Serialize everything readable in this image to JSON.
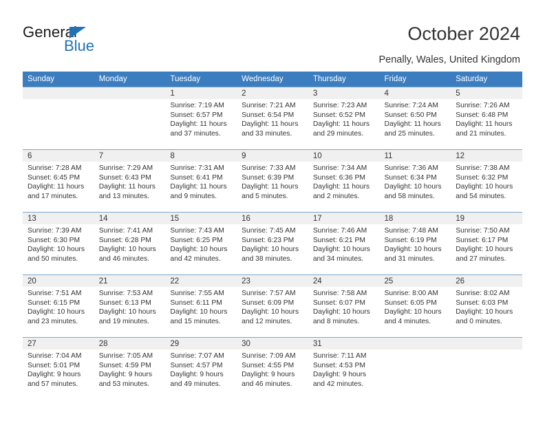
{
  "brand": {
    "name_top": "General",
    "name_bottom": "Blue",
    "accent_color": "#1f73b7",
    "triangle_icon": "triangle-icon"
  },
  "header": {
    "title": "October 2024",
    "subtitle": "Penally, Wales, United Kingdom"
  },
  "calendar": {
    "header_bg": "#3b7dbf",
    "header_text_color": "#ffffff",
    "daynum_band_bg": "#f0f0f0",
    "row_separator_color": "#7ba7cf",
    "weekday_headers": [
      "Sunday",
      "Monday",
      "Tuesday",
      "Wednesday",
      "Thursday",
      "Friday",
      "Saturday"
    ],
    "labels": {
      "sunrise": "Sunrise:",
      "sunset": "Sunset:",
      "daylight": "Daylight:"
    },
    "weeks": [
      [
        {
          "day": "",
          "empty": true
        },
        {
          "day": "",
          "empty": true
        },
        {
          "day": "1",
          "sunrise": "Sunrise: 7:19 AM",
          "sunset": "Sunset: 6:57 PM",
          "daylight_line1": "Daylight: 11 hours",
          "daylight_line2": "and 37 minutes."
        },
        {
          "day": "2",
          "sunrise": "Sunrise: 7:21 AM",
          "sunset": "Sunset: 6:54 PM",
          "daylight_line1": "Daylight: 11 hours",
          "daylight_line2": "and 33 minutes."
        },
        {
          "day": "3",
          "sunrise": "Sunrise: 7:23 AM",
          "sunset": "Sunset: 6:52 PM",
          "daylight_line1": "Daylight: 11 hours",
          "daylight_line2": "and 29 minutes."
        },
        {
          "day": "4",
          "sunrise": "Sunrise: 7:24 AM",
          "sunset": "Sunset: 6:50 PM",
          "daylight_line1": "Daylight: 11 hours",
          "daylight_line2": "and 25 minutes."
        },
        {
          "day": "5",
          "sunrise": "Sunrise: 7:26 AM",
          "sunset": "Sunset: 6:48 PM",
          "daylight_line1": "Daylight: 11 hours",
          "daylight_line2": "and 21 minutes."
        }
      ],
      [
        {
          "day": "6",
          "sunrise": "Sunrise: 7:28 AM",
          "sunset": "Sunset: 6:45 PM",
          "daylight_line1": "Daylight: 11 hours",
          "daylight_line2": "and 17 minutes."
        },
        {
          "day": "7",
          "sunrise": "Sunrise: 7:29 AM",
          "sunset": "Sunset: 6:43 PM",
          "daylight_line1": "Daylight: 11 hours",
          "daylight_line2": "and 13 minutes."
        },
        {
          "day": "8",
          "sunrise": "Sunrise: 7:31 AM",
          "sunset": "Sunset: 6:41 PM",
          "daylight_line1": "Daylight: 11 hours",
          "daylight_line2": "and 9 minutes."
        },
        {
          "day": "9",
          "sunrise": "Sunrise: 7:33 AM",
          "sunset": "Sunset: 6:39 PM",
          "daylight_line1": "Daylight: 11 hours",
          "daylight_line2": "and 5 minutes."
        },
        {
          "day": "10",
          "sunrise": "Sunrise: 7:34 AM",
          "sunset": "Sunset: 6:36 PM",
          "daylight_line1": "Daylight: 11 hours",
          "daylight_line2": "and 2 minutes."
        },
        {
          "day": "11",
          "sunrise": "Sunrise: 7:36 AM",
          "sunset": "Sunset: 6:34 PM",
          "daylight_line1": "Daylight: 10 hours",
          "daylight_line2": "and 58 minutes."
        },
        {
          "day": "12",
          "sunrise": "Sunrise: 7:38 AM",
          "sunset": "Sunset: 6:32 PM",
          "daylight_line1": "Daylight: 10 hours",
          "daylight_line2": "and 54 minutes."
        }
      ],
      [
        {
          "day": "13",
          "sunrise": "Sunrise: 7:39 AM",
          "sunset": "Sunset: 6:30 PM",
          "daylight_line1": "Daylight: 10 hours",
          "daylight_line2": "and 50 minutes."
        },
        {
          "day": "14",
          "sunrise": "Sunrise: 7:41 AM",
          "sunset": "Sunset: 6:28 PM",
          "daylight_line1": "Daylight: 10 hours",
          "daylight_line2": "and 46 minutes."
        },
        {
          "day": "15",
          "sunrise": "Sunrise: 7:43 AM",
          "sunset": "Sunset: 6:25 PM",
          "daylight_line1": "Daylight: 10 hours",
          "daylight_line2": "and 42 minutes."
        },
        {
          "day": "16",
          "sunrise": "Sunrise: 7:45 AM",
          "sunset": "Sunset: 6:23 PM",
          "daylight_line1": "Daylight: 10 hours",
          "daylight_line2": "and 38 minutes."
        },
        {
          "day": "17",
          "sunrise": "Sunrise: 7:46 AM",
          "sunset": "Sunset: 6:21 PM",
          "daylight_line1": "Daylight: 10 hours",
          "daylight_line2": "and 34 minutes."
        },
        {
          "day": "18",
          "sunrise": "Sunrise: 7:48 AM",
          "sunset": "Sunset: 6:19 PM",
          "daylight_line1": "Daylight: 10 hours",
          "daylight_line2": "and 31 minutes."
        },
        {
          "day": "19",
          "sunrise": "Sunrise: 7:50 AM",
          "sunset": "Sunset: 6:17 PM",
          "daylight_line1": "Daylight: 10 hours",
          "daylight_line2": "and 27 minutes."
        }
      ],
      [
        {
          "day": "20",
          "sunrise": "Sunrise: 7:51 AM",
          "sunset": "Sunset: 6:15 PM",
          "daylight_line1": "Daylight: 10 hours",
          "daylight_line2": "and 23 minutes."
        },
        {
          "day": "21",
          "sunrise": "Sunrise: 7:53 AM",
          "sunset": "Sunset: 6:13 PM",
          "daylight_line1": "Daylight: 10 hours",
          "daylight_line2": "and 19 minutes."
        },
        {
          "day": "22",
          "sunrise": "Sunrise: 7:55 AM",
          "sunset": "Sunset: 6:11 PM",
          "daylight_line1": "Daylight: 10 hours",
          "daylight_line2": "and 15 minutes."
        },
        {
          "day": "23",
          "sunrise": "Sunrise: 7:57 AM",
          "sunset": "Sunset: 6:09 PM",
          "daylight_line1": "Daylight: 10 hours",
          "daylight_line2": "and 12 minutes."
        },
        {
          "day": "24",
          "sunrise": "Sunrise: 7:58 AM",
          "sunset": "Sunset: 6:07 PM",
          "daylight_line1": "Daylight: 10 hours",
          "daylight_line2": "and 8 minutes."
        },
        {
          "day": "25",
          "sunrise": "Sunrise: 8:00 AM",
          "sunset": "Sunset: 6:05 PM",
          "daylight_line1": "Daylight: 10 hours",
          "daylight_line2": "and 4 minutes."
        },
        {
          "day": "26",
          "sunrise": "Sunrise: 8:02 AM",
          "sunset": "Sunset: 6:03 PM",
          "daylight_line1": "Daylight: 10 hours",
          "daylight_line2": "and 0 minutes."
        }
      ],
      [
        {
          "day": "27",
          "sunrise": "Sunrise: 7:04 AM",
          "sunset": "Sunset: 5:01 PM",
          "daylight_line1": "Daylight: 9 hours",
          "daylight_line2": "and 57 minutes."
        },
        {
          "day": "28",
          "sunrise": "Sunrise: 7:05 AM",
          "sunset": "Sunset: 4:59 PM",
          "daylight_line1": "Daylight: 9 hours",
          "daylight_line2": "and 53 minutes."
        },
        {
          "day": "29",
          "sunrise": "Sunrise: 7:07 AM",
          "sunset": "Sunset: 4:57 PM",
          "daylight_line1": "Daylight: 9 hours",
          "daylight_line2": "and 49 minutes."
        },
        {
          "day": "30",
          "sunrise": "Sunrise: 7:09 AM",
          "sunset": "Sunset: 4:55 PM",
          "daylight_line1": "Daylight: 9 hours",
          "daylight_line2": "and 46 minutes."
        },
        {
          "day": "31",
          "sunrise": "Sunrise: 7:11 AM",
          "sunset": "Sunset: 4:53 PM",
          "daylight_line1": "Daylight: 9 hours",
          "daylight_line2": "and 42 minutes."
        },
        {
          "day": "",
          "empty": true
        },
        {
          "day": "",
          "empty": true
        }
      ]
    ]
  }
}
